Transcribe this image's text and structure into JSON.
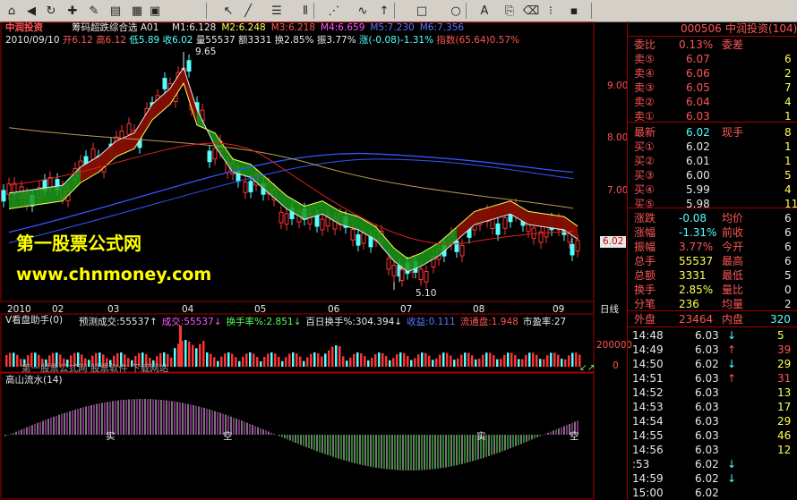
{
  "toolbar": {
    "icons": [
      "home-icon",
      "back-icon",
      "refresh-icon",
      "bookmark-icon",
      "pen-icon",
      "chart-icon",
      "grid-icon",
      "window-icon",
      "cursor-icon",
      "line-icon",
      "hlines-icon",
      "vlines-icon",
      "fan-icon",
      "wave-icon",
      "arrow-up-icon",
      "rect-icon",
      "ellipse-icon",
      "text-icon",
      "copy-icon",
      "eraser-icon",
      "dots-icon",
      "save-icon"
    ]
  },
  "chart": {
    "stock_name": "中润投资",
    "indicator_name": "筹码超跌综合选 A01",
    "ma_labels": [
      {
        "text": "M1:6.128",
        "color": "#e8e8e8"
      },
      {
        "text": "M2:6.248",
        "color": "#ffff55"
      },
      {
        "text": "M3:6.218",
        "color": "#ff5555"
      },
      {
        "text": "M4:6.659",
        "color": "#ff55ff"
      },
      {
        "text": "M5:7.230",
        "color": "#5577ff"
      },
      {
        "text": "M6:7.356",
        "color": "#5577ff"
      }
    ],
    "info_line": {
      "date": "2010/09/10",
      "open": "开6.12",
      "high": "高6.12",
      "low": "低5.89",
      "close": "收6.02",
      "vol": "量55537",
      "amount": "额3331",
      "turnover": "换2.85%",
      "amplitude": "振3.77%",
      "change": "涨(-0.08)-1.31%",
      "index": "指数(65.64)0.57%"
    },
    "high_marker": "9.65",
    "low_marker": "5.10",
    "current_price_tag": "6.02",
    "y_ticks": [
      "9.00",
      "8.00",
      "7.00"
    ],
    "x_ticks": [
      "2010",
      "02",
      "03",
      "04",
      "05",
      "06",
      "07",
      "08",
      "09"
    ],
    "period_label": "日线",
    "watermark_line1": "第一股票公式网",
    "watermark_line2": "www.chnmoney.com"
  },
  "volume_panel": {
    "title": "V看盘助手(0)",
    "items": [
      {
        "text": "预测成交:55537↑",
        "color": "#e8e8e8"
      },
      {
        "text": "成交:55537↓",
        "color": "#ff55ff"
      },
      {
        "text": "换手率%:2.851↓",
        "color": "#55ff55"
      },
      {
        "text": "百日换手%:304.394↓",
        "color": "#e8e8e8"
      },
      {
        "text": "收益:0.111",
        "color": "#5577ff"
      },
      {
        "text": "流通盘:1.948",
        "color": "#ff5555"
      },
      {
        "text": "市盈率:27",
        "color": "#e8e8e8"
      }
    ],
    "y_label_top": "200000",
    "y_label_bottom": "0",
    "footer_text": "第一股票公式网 股票软件 下载网站",
    "corner_marker": "↙↗"
  },
  "osc_panel": {
    "title": "高山流水(14)",
    "labels": [
      "实",
      "空",
      "实",
      "空"
    ]
  },
  "quote": {
    "code": "000506",
    "name": "中润投资(104)",
    "ratio": {
      "label": "委比",
      "value": "0.13%",
      "label2": "委差"
    },
    "sells": [
      {
        "label": "卖⑤",
        "price": "6.07",
        "vol": "6"
      },
      {
        "label": "卖④",
        "price": "6.06",
        "vol": "2"
      },
      {
        "label": "卖③",
        "price": "6.05",
        "vol": "7"
      },
      {
        "label": "卖②",
        "price": "6.04",
        "vol": "4"
      },
      {
        "label": "卖①",
        "price": "6.03",
        "vol": "1"
      }
    ],
    "latest": {
      "label": "最新",
      "price": "6.02",
      "label2": "现手",
      "vol": "8"
    },
    "buys": [
      {
        "label": "买①",
        "price": "6.02",
        "vol": "1"
      },
      {
        "label": "买②",
        "price": "6.01",
        "vol": "1"
      },
      {
        "label": "买③",
        "price": "6.00",
        "vol": "5"
      },
      {
        "label": "买④",
        "price": "5.99",
        "vol": "4"
      },
      {
        "label": "买⑤",
        "price": "5.98",
        "vol": "11"
      }
    ],
    "stats": [
      {
        "l1": "涨跌",
        "v1": "-0.08",
        "l2": "均价",
        "v2": "6"
      },
      {
        "l1": "涨幅",
        "v1": "-1.31%",
        "l2": "前收",
        "v2": "6"
      },
      {
        "l1": "振幅",
        "v1": "3.77%",
        "l2": "今开",
        "v2": "6"
      },
      {
        "l1": "总手",
        "v1": "55537",
        "l2": "最高",
        "v2": "6"
      },
      {
        "l1": "总额",
        "v1": "3331",
        "l2": "最低",
        "v2": "5"
      },
      {
        "l1": "换手",
        "v1": "2.85%",
        "l2": "量比",
        "v2": "0"
      },
      {
        "l1": "分笔",
        "v1": "236",
        "l2": "均量",
        "v2": "2"
      }
    ],
    "outer": {
      "label": "外盘",
      "value": "23464",
      "label2": "内盘",
      "value2": "320"
    },
    "ticks": [
      {
        "time": "14:48",
        "price": "6.03",
        "dir": "↓",
        "vol": "5"
      },
      {
        "time": "14:49",
        "price": "6.03",
        "dir": "↑",
        "vol": "39"
      },
      {
        "time": "14:50",
        "price": "6.02",
        "dir": "↓",
        "vol": "29"
      },
      {
        "time": "14:51",
        "price": "6.03",
        "dir": "↑",
        "vol": "31"
      },
      {
        "time": "14:52",
        "price": "6.03",
        "dir": "",
        "vol": "13"
      },
      {
        "time": "14:53",
        "price": "6.03",
        "dir": "",
        "vol": "17"
      },
      {
        "time": "14:54",
        "price": "6.03",
        "dir": "",
        "vol": "29"
      },
      {
        "time": "14:55",
        "price": "6.03",
        "dir": "",
        "vol": "46"
      },
      {
        "time": "14:56",
        "price": "6.03",
        "dir": "",
        "vol": "12"
      },
      {
        "time": ":53",
        "price": "6.02",
        "dir": "↓",
        "vol": ""
      },
      {
        "time": "14:59",
        "price": "6.02",
        "dir": "↓",
        "vol": ""
      },
      {
        "time": "15:00",
        "price": "6.02",
        "dir": "",
        "vol": ""
      }
    ]
  }
}
